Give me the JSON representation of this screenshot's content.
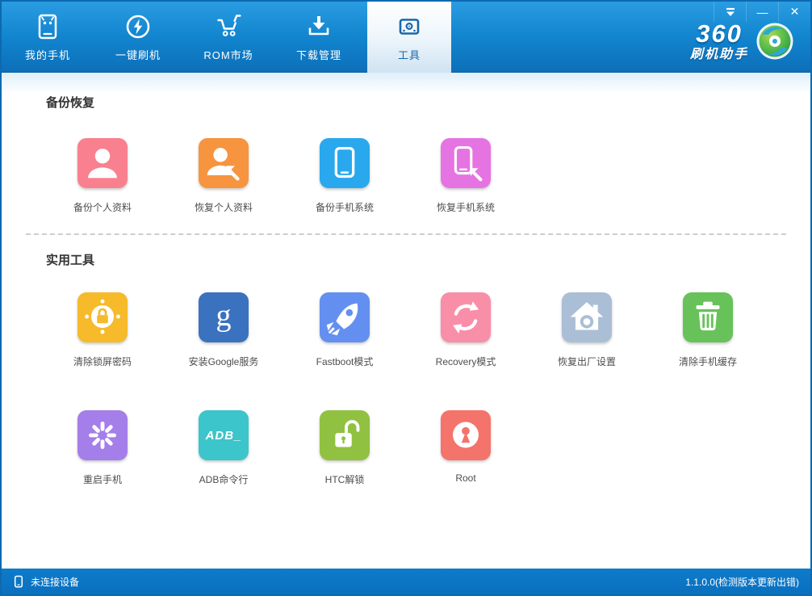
{
  "window_controls": {
    "minimize": "—",
    "close": "✕"
  },
  "brand": {
    "line1": "360",
    "line2": "刷机助手"
  },
  "nav": {
    "tabs": [
      {
        "label": "我的手机",
        "icon": "my-phone-icon",
        "active": false
      },
      {
        "label": "一键刷机",
        "icon": "one-key-flash-icon",
        "active": false
      },
      {
        "label": "ROM市场",
        "icon": "rom-market-cart-icon",
        "active": false
      },
      {
        "label": "下载管理",
        "icon": "download-manager-icon",
        "active": false
      },
      {
        "label": "工具",
        "icon": "toolbox-icon",
        "active": true
      }
    ]
  },
  "sections": {
    "backup": {
      "title": "备份恢复",
      "items": [
        {
          "label": "备份个人资料",
          "color": "#f9808f",
          "icon": "person-icon"
        },
        {
          "label": "恢复个人资料",
          "color": "#f79440",
          "icon": "person-restore-icon"
        },
        {
          "label": "备份手机系统",
          "color": "#29a8ee",
          "icon": "phone-icon"
        },
        {
          "label": "恢复手机系统",
          "color": "#e574e2",
          "icon": "phone-restore-icon"
        }
      ]
    },
    "tools": {
      "title": "实用工具",
      "items": [
        {
          "label": "清除锁屏密码",
          "color": "#f6ba2a",
          "icon": "lock-target-icon"
        },
        {
          "label": "安装Google服务",
          "color": "#3b72bf",
          "icon": "google-g-icon",
          "glyph": "g"
        },
        {
          "label": "Fastboot模式",
          "color": "#638ff0",
          "icon": "rocket-icon"
        },
        {
          "label": "Recovery模式",
          "color": "#f98ea8",
          "icon": "refresh-icon"
        },
        {
          "label": "恢复出厂设置",
          "color": "#aabfd6",
          "icon": "home-reset-icon"
        },
        {
          "label": "清除手机缓存",
          "color": "#67c25a",
          "icon": "trash-icon"
        },
        {
          "label": "重启手机",
          "color": "#a47ee9",
          "icon": "spinner-icon"
        },
        {
          "label": "ADB命令行",
          "color": "#3cc5ca",
          "icon": "adb-terminal-icon",
          "glyph": "ADB_"
        },
        {
          "label": "HTC解锁",
          "color": "#90c140",
          "icon": "unlock-icon"
        },
        {
          "label": "Root",
          "color": "#f4736b",
          "icon": "root-keyhole-icon"
        }
      ]
    }
  },
  "statusbar": {
    "device_status": "未连接设备",
    "version": "1.1.0.0(检测版本更新出错)"
  }
}
